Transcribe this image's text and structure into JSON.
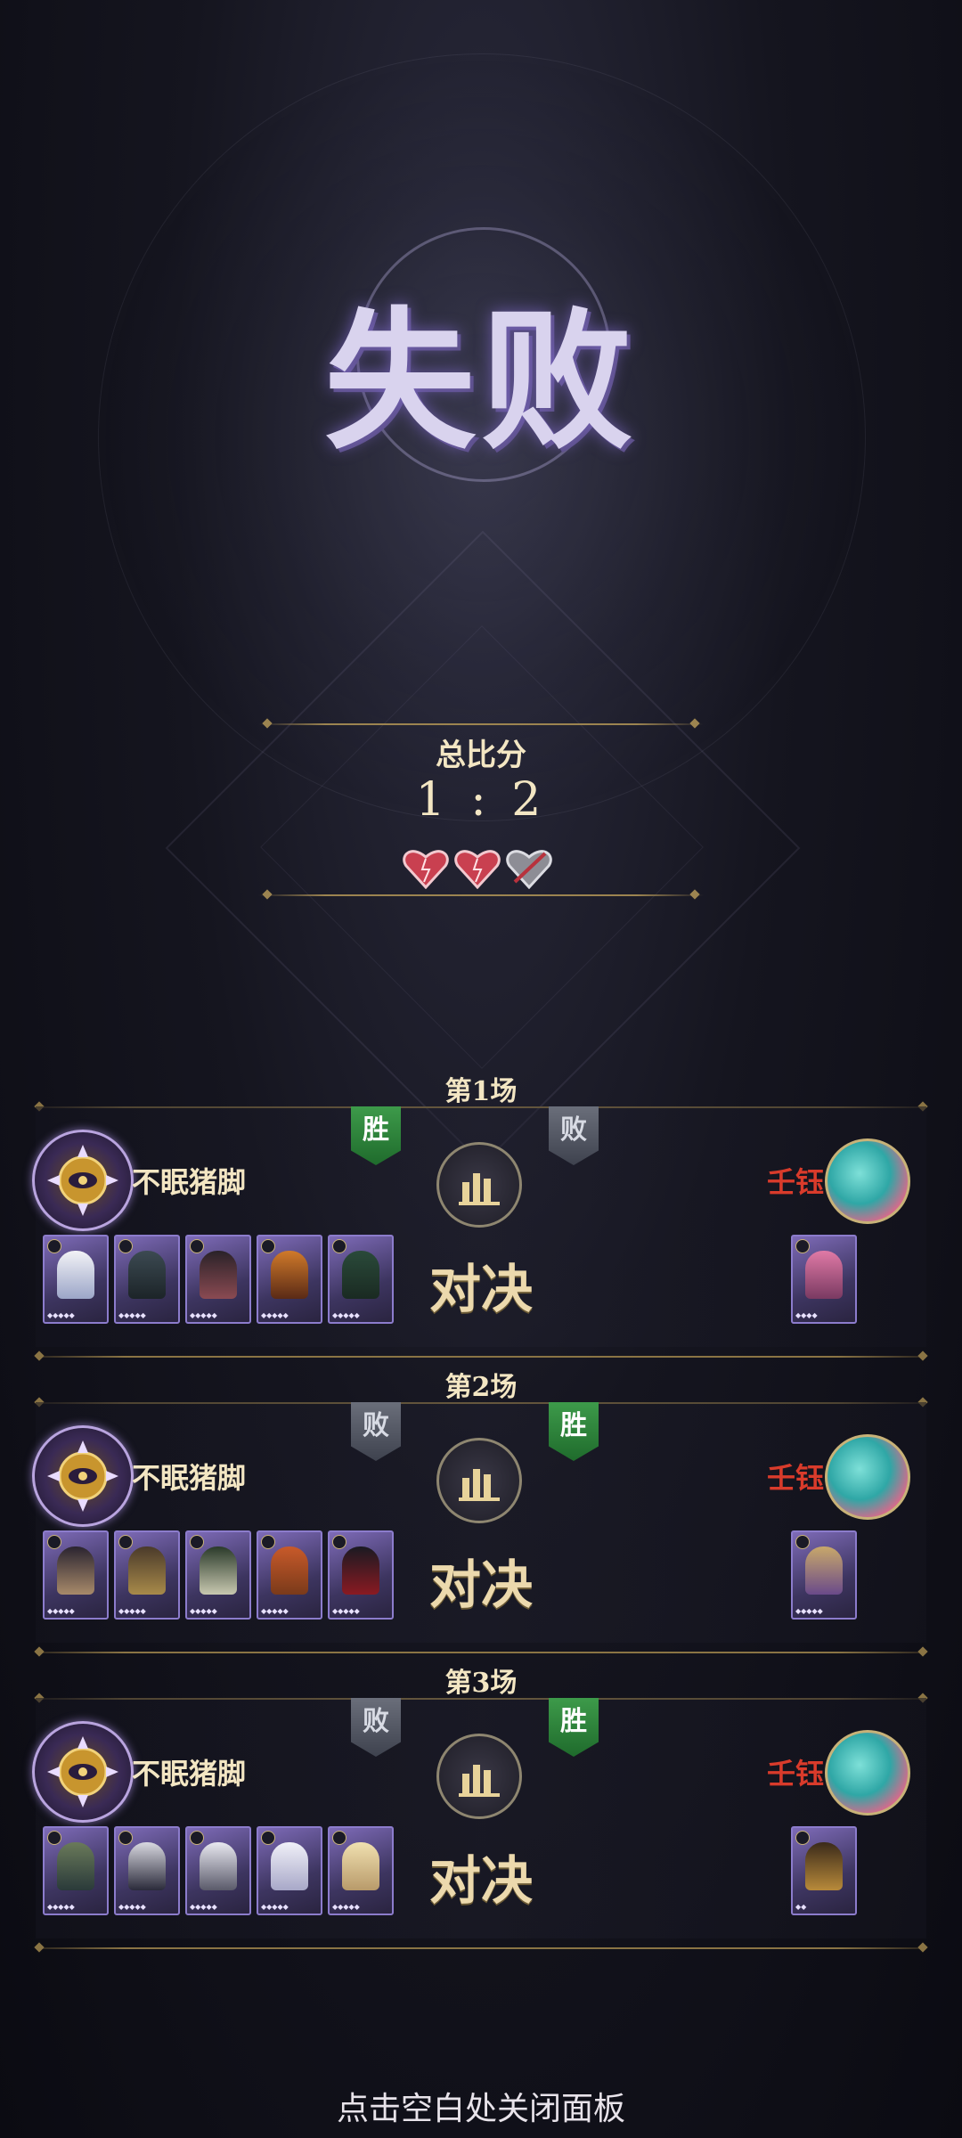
{
  "result_title": "失败",
  "score": {
    "label": "总比分",
    "value": "1 : 2"
  },
  "hearts": [
    {
      "state": "full",
      "icon": "heart-full-icon"
    },
    {
      "state": "full",
      "icon": "heart-full-icon"
    },
    {
      "state": "broken",
      "icon": "heart-broken-icon"
    }
  ],
  "rounds": [
    {
      "title": "第1场",
      "player": {
        "name": "不眠猪脚",
        "result": "胜"
      },
      "opponent": {
        "name": "壬钰",
        "result": "败"
      },
      "vs_label": "对决",
      "player_cards": 5,
      "opponent_cards": 1
    },
    {
      "title": "第2场",
      "player": {
        "name": "不眠猪脚",
        "result": "败"
      },
      "opponent": {
        "name": "壬钰",
        "result": "胜"
      },
      "vs_label": "对决",
      "player_cards": 5,
      "opponent_cards": 1
    },
    {
      "title": "第3场",
      "player": {
        "name": "不眠猪脚",
        "result": "败"
      },
      "opponent": {
        "name": "壬钰",
        "result": "胜"
      },
      "vs_label": "对决",
      "player_cards": 5,
      "opponent_cards": 1
    }
  ],
  "footer_hint": "点击空白处关闭面板",
  "colors": {
    "win": "#2f8a3c",
    "lose": "#555a66",
    "gold": "#f3e6c3",
    "opponent_name": "#d93b2b"
  }
}
